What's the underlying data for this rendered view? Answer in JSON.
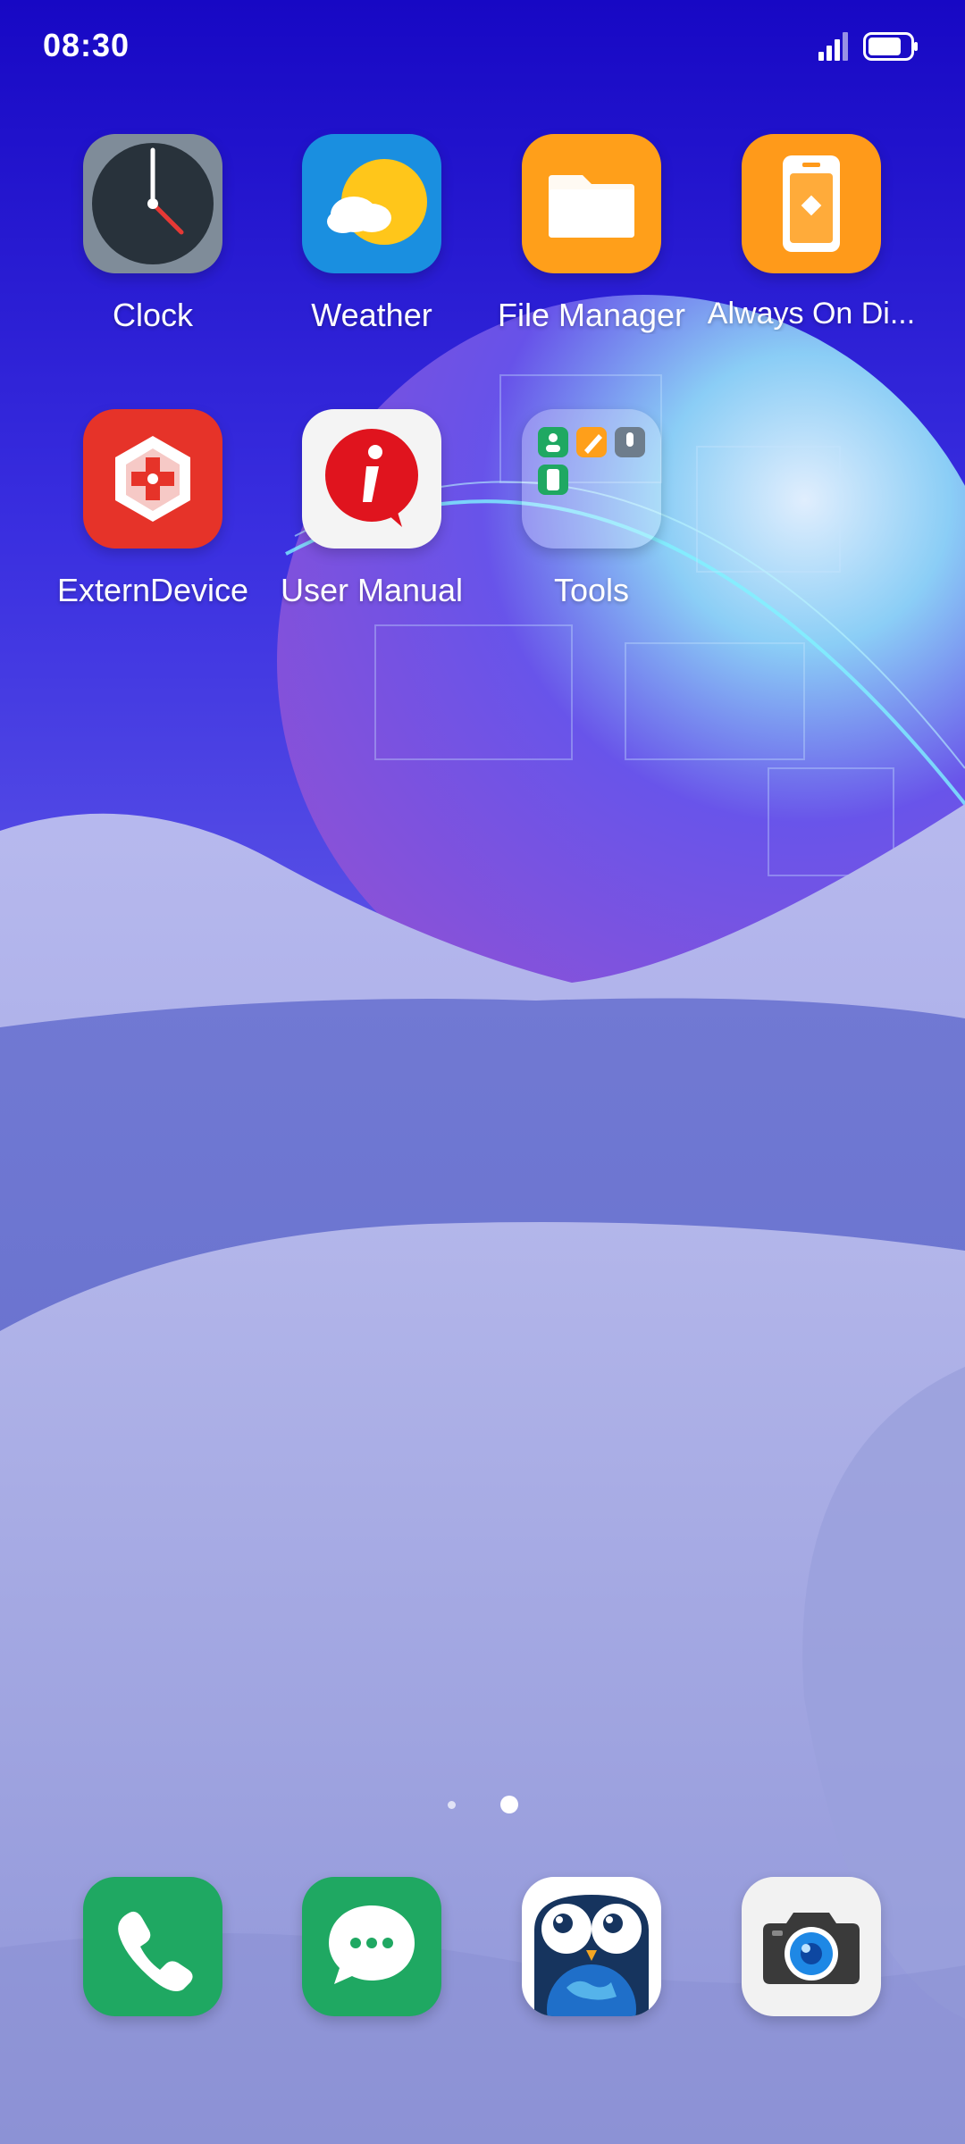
{
  "status_bar": {
    "time": "08:30",
    "signal_icon": "signal-icon",
    "battery_icon": "battery-icon"
  },
  "apps": [
    {
      "id": "clock",
      "label": "Clock",
      "icon": "clock-icon"
    },
    {
      "id": "weather",
      "label": "Weather",
      "icon": "weather-icon"
    },
    {
      "id": "file-manager",
      "label": "File Manager",
      "icon": "folder-icon"
    },
    {
      "id": "always-on-display",
      "label": "Always On Di...",
      "icon": "always-on-display-icon"
    },
    {
      "id": "externdevice",
      "label": "ExternDevice",
      "icon": "externdevice-icon"
    },
    {
      "id": "user-manual",
      "label": "User Manual",
      "icon": "info-icon"
    },
    {
      "id": "tools",
      "label": "Tools",
      "icon": "folder-tools-icon"
    }
  ],
  "page_indicator": {
    "pages": 2,
    "current": 2
  },
  "dock": [
    {
      "id": "phone",
      "icon": "phone-icon"
    },
    {
      "id": "messages",
      "icon": "messages-icon"
    },
    {
      "id": "owl-app",
      "icon": "owl-icon"
    },
    {
      "id": "camera",
      "icon": "camera-icon"
    }
  ],
  "colors": {
    "sky_top": "#1a12c9",
    "sky_mid": "#4c43e0",
    "dune": "#a9b0e6",
    "accent_green": "#1fa862",
    "accent_orange": "#ff9f1a",
    "accent_red": "#e63329"
  }
}
